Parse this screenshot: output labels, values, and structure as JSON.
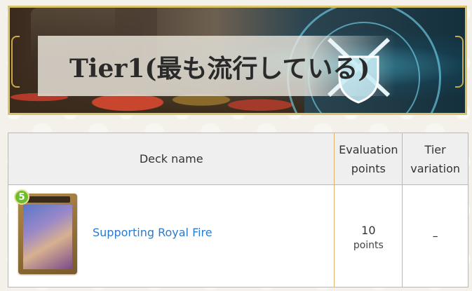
{
  "banner": {
    "title": "Tier1(最も流行している)"
  },
  "table": {
    "headers": {
      "deck_name": "Deck name",
      "evaluation_points": "Evaluation points",
      "tier_variation": "Tier variation"
    },
    "rows": [
      {
        "card_cost": "5",
        "deck_name": "Supporting Royal Fire",
        "evaluation_value": "10",
        "evaluation_unit": "points",
        "tier_variation": "–"
      }
    ]
  },
  "colors": {
    "link": "#2a7bd0",
    "table_border": "#e2b26c",
    "header_bg": "#efefef"
  }
}
